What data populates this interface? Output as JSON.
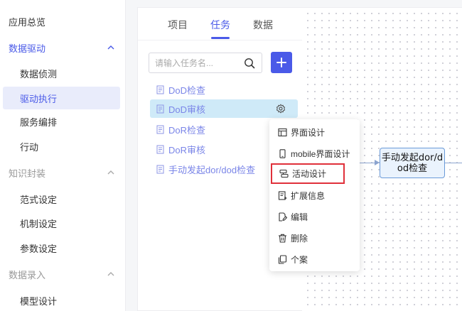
{
  "sidebar": {
    "groups": [
      {
        "label": "应用总览"
      },
      {
        "label": "数据驱动",
        "items": [
          "数据侦测",
          "驱动执行",
          "服务编排",
          "行动"
        ]
      },
      {
        "label": "知识封装",
        "items": [
          "范式设定",
          "机制设定",
          "参数设定"
        ]
      },
      {
        "label": "数据录入",
        "items": [
          "模型设计"
        ]
      }
    ]
  },
  "panel": {
    "tabs": [
      "项目",
      "任务",
      "数据"
    ],
    "active_tab": "任务",
    "search": {
      "placeholder": "请输入任务名...",
      "value": ""
    },
    "tasks": [
      "DoD检查",
      "DoD审核",
      "DoR检查",
      "DoR审核",
      "手动发起dor/dod检查"
    ]
  },
  "context_menu": {
    "items": [
      {
        "label": "界面设计",
        "icon": "layout-icon"
      },
      {
        "label": "mobile界面设计",
        "icon": "mobile-icon"
      },
      {
        "label": "活动设计",
        "icon": "activity-icon"
      },
      {
        "label": "扩展信息",
        "icon": "extend-icon"
      },
      {
        "label": "编辑",
        "icon": "edit-icon"
      },
      {
        "label": "删除",
        "icon": "delete-icon"
      },
      {
        "label": "个案",
        "icon": "copy-icon"
      }
    ],
    "highlighted": "活动设计"
  },
  "canvas": {
    "node": {
      "line1": "手动发起dor/d",
      "line2": "od检查"
    }
  },
  "colors": {
    "accent": "#4a5ae8",
    "selected_task_bg": "#cfeaf8",
    "highlight_border": "#e0303a"
  }
}
